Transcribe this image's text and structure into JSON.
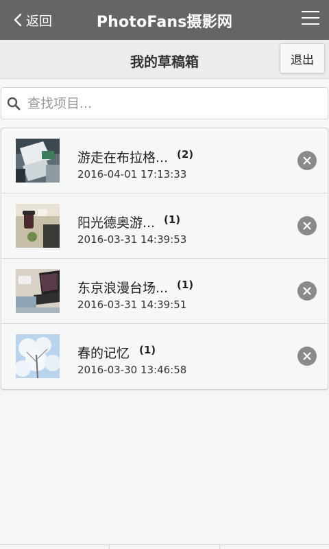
{
  "header": {
    "back_label": "返回",
    "title": "PhotoFans摄影网",
    "menu_icon": "hamburger-icon"
  },
  "subheader": {
    "title": "我的草稿箱",
    "logout_label": "退出"
  },
  "search": {
    "placeholder": "查找项目..."
  },
  "drafts": [
    {
      "title": "游走在布拉格...",
      "count": "(2)",
      "date": "2016-04-01 17:13:33",
      "thumb": "desk-papers"
    },
    {
      "title": "阳光德奥游...",
      "count": "(1)",
      "date": "2016-03-31 14:39:53",
      "thumb": "table-cup"
    },
    {
      "title": "东京浪漫台场...",
      "count": "(1)",
      "date": "2016-03-31 14:39:51",
      "thumb": "laptop-desk"
    },
    {
      "title": "春的记忆",
      "count": "(1)",
      "date": "2016-03-30 13:46:58",
      "thumb": "snow-tree"
    }
  ],
  "colors": {
    "topbar": "#656565",
    "delete_button": "#8a8a8a"
  }
}
